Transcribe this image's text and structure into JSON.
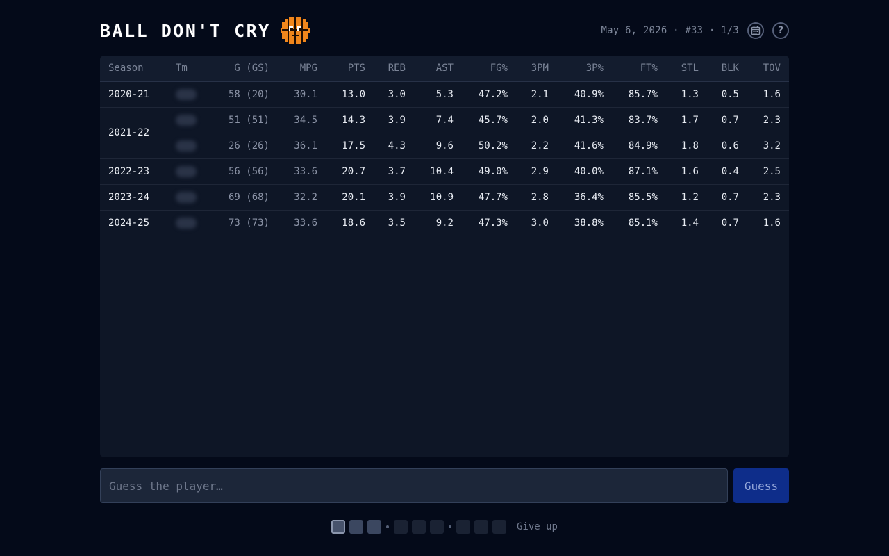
{
  "header": {
    "title": "BALL DON'T CRY",
    "logo_icon": "basketball-pixel-icon",
    "meta": "May 6, 2026 · #33 · 1/3",
    "calendar_icon": "calendar-icon",
    "help_icon": "help-icon",
    "help_glyph": "?"
  },
  "table": {
    "columns": [
      "Season",
      "Tm",
      "G (GS)",
      "MPG",
      "PTS",
      "REB",
      "AST",
      "FG%",
      "3PM",
      "3P%",
      "FT%",
      "STL",
      "BLK",
      "TOV"
    ],
    "rows": [
      {
        "season": "2020-21",
        "team": "",
        "g": "58 (20)",
        "mpg": "30.1",
        "pts": "13.0",
        "reb": "3.0",
        "ast": "5.3",
        "fg": "47.2%",
        "tpm": "2.1",
        "tp": "40.9%",
        "ft": "85.7%",
        "stl": "1.3",
        "blk": "0.5",
        "tov": "1.6"
      },
      {
        "season": "2021-22",
        "team": "",
        "g": "51 (51)",
        "mpg": "34.5",
        "pts": "14.3",
        "reb": "3.9",
        "ast": "7.4",
        "fg": "45.7%",
        "tpm": "2.0",
        "tp": "41.3%",
        "ft": "83.7%",
        "stl": "1.7",
        "blk": "0.7",
        "tov": "2.3"
      },
      {
        "season": "",
        "team": "",
        "g": "26 (26)",
        "mpg": "36.1",
        "pts": "17.5",
        "reb": "4.3",
        "ast": "9.6",
        "fg": "50.2%",
        "tpm": "2.2",
        "tp": "41.6%",
        "ft": "84.9%",
        "stl": "1.8",
        "blk": "0.6",
        "tov": "3.2"
      },
      {
        "season": "2022-23",
        "team": "",
        "g": "56 (56)",
        "mpg": "33.6",
        "pts": "20.7",
        "reb": "3.7",
        "ast": "10.4",
        "fg": "49.0%",
        "tpm": "2.9",
        "tp": "40.0%",
        "ft": "87.1%",
        "stl": "1.6",
        "blk": "0.4",
        "tov": "2.5"
      },
      {
        "season": "2023-24",
        "team": "",
        "g": "69 (68)",
        "mpg": "32.2",
        "pts": "20.1",
        "reb": "3.9",
        "ast": "10.9",
        "fg": "47.7%",
        "tpm": "2.8",
        "tp": "36.4%",
        "ft": "85.5%",
        "stl": "1.2",
        "blk": "0.7",
        "tov": "2.3"
      },
      {
        "season": "2024-25",
        "team": "",
        "g": "73 (73)",
        "mpg": "33.6",
        "pts": "18.6",
        "reb": "3.5",
        "ast": "9.2",
        "fg": "47.3%",
        "tpm": "3.0",
        "tp": "38.8%",
        "ft": "85.1%",
        "stl": "1.4",
        "blk": "0.7",
        "tov": "1.6"
      }
    ]
  },
  "guess": {
    "placeholder": "Guess the player…",
    "button_label": "Guess"
  },
  "progress": {
    "steps": [
      "current",
      "revealed",
      "revealed",
      "locked",
      "locked",
      "locked",
      "locked",
      "locked",
      "locked"
    ],
    "give_up_label": "Give up"
  },
  "colors": {
    "background": "#040a19",
    "panel": "#0e1626",
    "accent_button": "#0e2d8a",
    "ball_orange": "#f0861c"
  }
}
